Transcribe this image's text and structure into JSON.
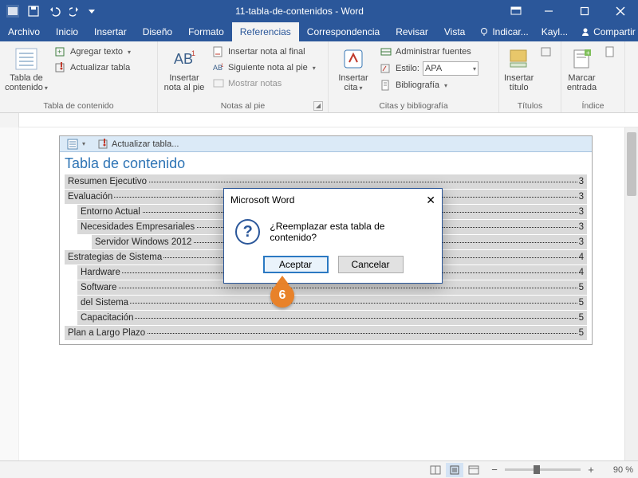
{
  "titlebar": {
    "title": "11-tabla-de-contenidos  -  Word"
  },
  "tabs": {
    "items": [
      "Archivo",
      "Inicio",
      "Insertar",
      "Diseño",
      "Formato",
      "Referencias",
      "Correspondencia",
      "Revisar",
      "Vista"
    ],
    "activeIndex": 5,
    "tellme": "Indicar...",
    "user": "Kayl...",
    "share": "Compartir"
  },
  "ribbon": {
    "g1": {
      "label": "Tabla de contenido",
      "big": "Tabla de contenido",
      "addText": "Agregar texto",
      "update": "Actualizar tabla"
    },
    "g2": {
      "label": "Notas al pie",
      "big": "Insertar nota al pie",
      "endnote": "Insertar nota al final",
      "next": "Siguiente nota al pie",
      "show": "Mostrar notas"
    },
    "g3": {
      "label": "Citas y bibliografía",
      "big": "Insertar cita",
      "manage": "Administrar fuentes",
      "styleLbl": "Estilo:",
      "styleVal": "APA",
      "biblio": "Bibliografía"
    },
    "g4": {
      "label": "Títulos",
      "big": "Insertar título"
    },
    "g5": {
      "label": "Índice",
      "big": "Marcar entrada"
    }
  },
  "toc": {
    "toolbar": {
      "update": "Actualizar tabla..."
    },
    "title": "Tabla de contenido",
    "entries": [
      {
        "text": "Resumen Ejecutivo",
        "page": "3",
        "level": 1
      },
      {
        "text": "Evaluación",
        "page": "3",
        "level": 1
      },
      {
        "text": "Entorno Actual",
        "page": "3",
        "level": 2
      },
      {
        "text": "Necesidades Empresariales",
        "page": "3",
        "level": 2
      },
      {
        "text": "Servidor Windows 2012",
        "page": "3",
        "level": 3
      },
      {
        "text": "Estrategias de Sistema",
        "page": "4",
        "level": 1
      },
      {
        "text": "Hardware",
        "page": "4",
        "level": 2
      },
      {
        "text": "Software",
        "page": "5",
        "level": 2
      },
      {
        "text": "del Sistema",
        "page": "5",
        "level": 2
      },
      {
        "text": "Capacitación",
        "page": "5",
        "level": 2
      },
      {
        "text": "Plan a Largo Plazo",
        "page": "5",
        "level": 1
      }
    ]
  },
  "dialog": {
    "title": "Microsoft Word",
    "message": "¿Reemplazar esta tabla de contenido?",
    "ok": "Aceptar",
    "cancel": "Cancelar"
  },
  "callout": "6",
  "status": {
    "zoom": "90 %"
  }
}
